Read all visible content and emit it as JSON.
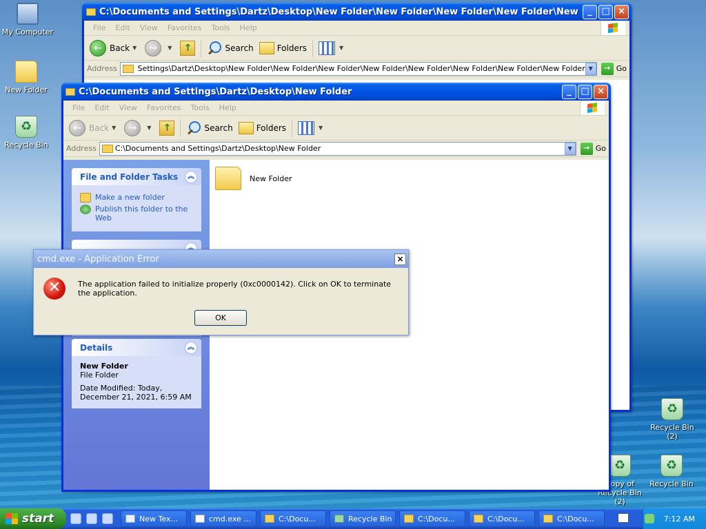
{
  "desktop": {
    "icons_left": [
      {
        "label": "My Computer",
        "icon": "computer-icon"
      },
      {
        "label": "New Folder",
        "icon": "folder-icon"
      },
      {
        "label": "Recycle Bin",
        "icon": "recycle-bin-icon"
      }
    ],
    "icons_right": [
      {
        "label": "Recycle Bin (2)",
        "icon": "recycle-bin-icon"
      },
      {
        "label": "Copy of Recycle Bin (2)",
        "icon": "recycle-bin-icon"
      },
      {
        "label": "Recycle Bin",
        "icon": "recycle-bin-icon"
      }
    ]
  },
  "window_back": {
    "title": "C:\\Documents and Settings\\Dartz\\Desktop\\New Folder\\New Folder\\New Folder\\New Folder\\New Folder\\",
    "address": "C:\\Documents and Settings\\Dartz\\Desktop\\New Folder\\New Folder\\New Folder\\New Folder\\New Folder\\New Folder\\New Folder\\New Folder"
  },
  "window_front": {
    "title": "C:\\Documents and Settings\\Dartz\\Desktop\\New Folder",
    "address": "C:\\Documents and Settings\\Dartz\\Desktop\\New Folder"
  },
  "menu": [
    "File",
    "Edit",
    "View",
    "Favorites",
    "Tools",
    "Help"
  ],
  "toolbar": {
    "back": "Back",
    "search": "Search",
    "folders": "Folders"
  },
  "address_label": "Address",
  "go_label": "Go",
  "tasks": {
    "file_folder_title": "File and Folder Tasks",
    "make_folder": "Make a new folder",
    "publish": "Publish this folder to the Web",
    "details_title": "Details",
    "details_name": "New Folder",
    "details_type": "File Folder",
    "details_modified": "Date Modified: Today, December 21, 2021, 6:59 AM"
  },
  "content": {
    "item_label": "New Folder"
  },
  "dialog": {
    "title": "cmd.exe - Application Error",
    "message": "The application failed to initialize properly (0xc0000142). Click on OK to terminate the application.",
    "ok": "OK",
    "close": "×"
  },
  "taskbar": {
    "start": "start",
    "buttons": [
      "New Tex...",
      "cmd.exe ...",
      "C:\\Docu...",
      "Recycle Bin",
      "C:\\Docu...",
      "C:\\Docu...",
      "C:\\Docu..."
    ],
    "time": "7:12 AM"
  },
  "colors": {
    "title_active": "#0054e3",
    "taskpane": "#7ba2e7",
    "start_green": "#3c9b37"
  }
}
